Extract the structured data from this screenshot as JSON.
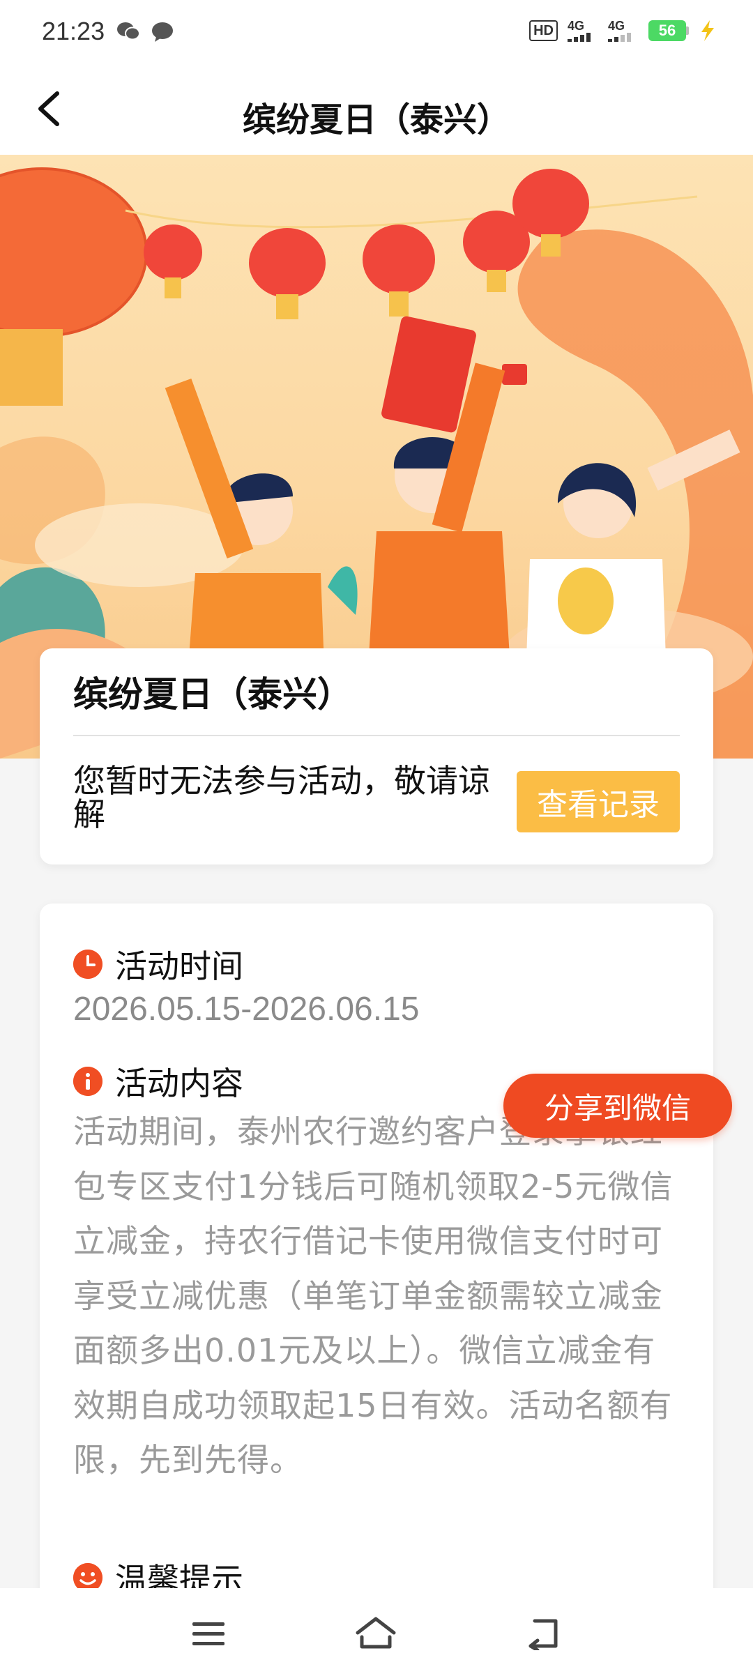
{
  "status_bar": {
    "time": "21:23",
    "hd_label": "HD",
    "net1": "4G",
    "net2": "4G",
    "battery": "56"
  },
  "nav": {
    "title": "缤纷夏日（泰兴）"
  },
  "info_card": {
    "title": "缤纷夏日（泰兴）",
    "message": "您暂时无法参与活动，敬请谅解",
    "record_button": "查看记录"
  },
  "detail": {
    "time_title": "活动时间",
    "time_value": "2026.05.15-2026.06.15",
    "content_title": "活动内容",
    "content_text": "活动期间，泰州农行邀约客户登录掌银红包专区支付1分钱后可随机领取2-5元微信立减金，持农行借记卡使用微信支付时可享受立减优惠（单笔订单金额需较立减金面额多出0.01元及以上）。微信立减金有效期自成功领取起15日有效。活动名额有限，先到先得。",
    "tips_title": "温馨提示"
  },
  "share_button": "分享到微信",
  "colors": {
    "accent_orange": "#ef4a22",
    "button_yellow": "#fbbd45",
    "banner_bg": "#fde3b4"
  }
}
